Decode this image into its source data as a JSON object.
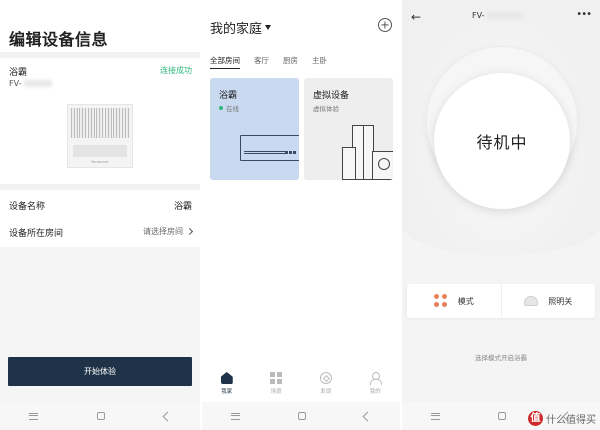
{
  "screen1": {
    "title": "编辑设备信息",
    "device_name": "浴霸",
    "connect_status": "连接成功",
    "model_prefix": "FV-",
    "device_brand_tiny": "Panasonic",
    "fields": [
      {
        "label": "设备名称",
        "value": "浴霸"
      },
      {
        "label": "设备所在房间",
        "value": "请选择房间"
      }
    ],
    "start_button": "开始体验"
  },
  "screen2": {
    "title": "我的家庭",
    "tabs": [
      "全部房间",
      "客厅",
      "厨房",
      "主卧"
    ],
    "cards": [
      {
        "name": "浴霸",
        "status": "在线"
      },
      {
        "name": "虚拟设备",
        "status": "虚拟体验"
      }
    ],
    "bottom_tabs": [
      "我家",
      "场景",
      "发现",
      "我的"
    ]
  },
  "screen3": {
    "title": "FV-",
    "more": "•••",
    "back": "←",
    "state": "待机中",
    "controls": [
      "模式",
      "照明关"
    ],
    "hint": "选择模式开启浴霸"
  },
  "watermark": {
    "logo": "值",
    "text": "什么值得买"
  },
  "colors": {
    "accent": "#2db67d",
    "dark_button": "#1e3347",
    "card_blue": "#c9d9f0",
    "mode_orange": "#e8805a"
  }
}
